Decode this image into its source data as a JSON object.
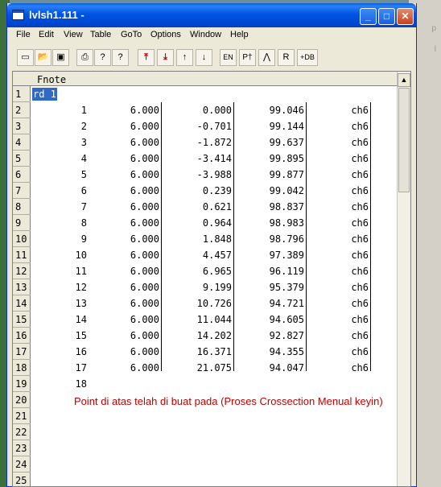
{
  "window": {
    "title": "lvlsh1.111 -",
    "minimize_glyph": "_",
    "maximize_glyph": "□",
    "close_glyph": "✕"
  },
  "background": {
    "ghost_texts": [
      "p",
      "l"
    ]
  },
  "menu": [
    "File",
    "Edit",
    "View",
    "Table",
    "GoTo",
    "Options",
    "Window",
    "Help"
  ],
  "toolbar": {
    "buttons": [
      {
        "name": "new-file-icon",
        "glyph": "▭"
      },
      {
        "name": "open-folder-icon",
        "glyph": "📂"
      },
      {
        "name": "save-disk-icon",
        "glyph": "▣"
      },
      {
        "name": "print-icon",
        "glyph": "⎙"
      },
      {
        "name": "help-icon",
        "glyph": "?"
      },
      {
        "name": "context-help-icon",
        "glyph": "?"
      },
      {
        "name": "first-row-icon",
        "glyph": "⤒"
      },
      {
        "name": "last-row-icon",
        "glyph": "⤓"
      },
      {
        "name": "row-up-icon",
        "glyph": "↑"
      },
      {
        "name": "row-down-icon",
        "glyph": "↓"
      },
      {
        "name": "en-icon",
        "glyph": "EN"
      },
      {
        "name": "pt-icon",
        "glyph": "P†"
      },
      {
        "name": "peak-icon",
        "glyph": "⋀"
      },
      {
        "name": "r-icon",
        "glyph": "R"
      },
      {
        "name": "db-icon",
        "glyph": "+DB"
      }
    ]
  },
  "sheet": {
    "column_title": "Fnote",
    "selected_text": "rd 1",
    "row_numbers": [
      "1",
      "2",
      "3",
      "4",
      "5",
      "6",
      "7",
      "8",
      "9",
      "10",
      "11",
      "12",
      "13",
      "14",
      "15",
      "16",
      "17",
      "18",
      "19",
      "20",
      "21",
      "22",
      "23",
      "24",
      "25"
    ],
    "rows": [
      [
        "1",
        "6.000",
        "0.000",
        "99.046",
        "ch6"
      ],
      [
        "2",
        "6.000",
        "-0.701",
        "99.144",
        "ch6"
      ],
      [
        "3",
        "6.000",
        "-1.872",
        "99.637",
        "ch6"
      ],
      [
        "4",
        "6.000",
        "-3.414",
        "99.895",
        "ch6"
      ],
      [
        "5",
        "6.000",
        "-3.988",
        "99.877",
        "ch6"
      ],
      [
        "6",
        "6.000",
        "0.239",
        "99.042",
        "ch6"
      ],
      [
        "7",
        "6.000",
        "0.621",
        "98.837",
        "ch6"
      ],
      [
        "8",
        "6.000",
        "0.964",
        "98.983",
        "ch6"
      ],
      [
        "9",
        "6.000",
        "1.848",
        "98.796",
        "ch6"
      ],
      [
        "10",
        "6.000",
        "4.457",
        "97.389",
        "ch6"
      ],
      [
        "11",
        "6.000",
        "6.965",
        "96.119",
        "ch6"
      ],
      [
        "12",
        "6.000",
        "9.199",
        "95.379",
        "ch6"
      ],
      [
        "13",
        "6.000",
        "10.726",
        "94.721",
        "ch6"
      ],
      [
        "14",
        "6.000",
        "11.044",
        "94.605",
        "ch6"
      ],
      [
        "15",
        "6.000",
        "14.202",
        "92.827",
        "ch6"
      ],
      [
        "16",
        "6.000",
        "16.371",
        "94.355",
        "ch6"
      ],
      [
        "17",
        "6.000",
        "21.075",
        "94.047",
        "ch6"
      ]
    ],
    "last_index": "18",
    "note": "Point di atas telah di buat pada (Proses Crossection Menual keyin)"
  }
}
